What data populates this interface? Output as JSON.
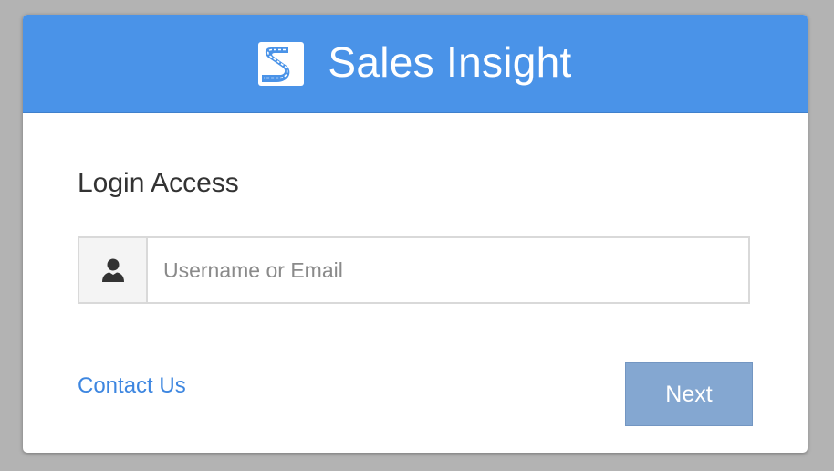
{
  "header": {
    "title": "Sales Insight",
    "logo_icon": "sales-insight-logo-icon",
    "background_color": "#4a93e8"
  },
  "login": {
    "heading": "Login Access",
    "username_placeholder": "Username or Email",
    "username_value": "",
    "user_icon": "user-icon"
  },
  "footer": {
    "contact_label": "Contact Us",
    "next_label": "Next",
    "link_color": "#3d86e0",
    "button_color": "#84a7d1"
  }
}
